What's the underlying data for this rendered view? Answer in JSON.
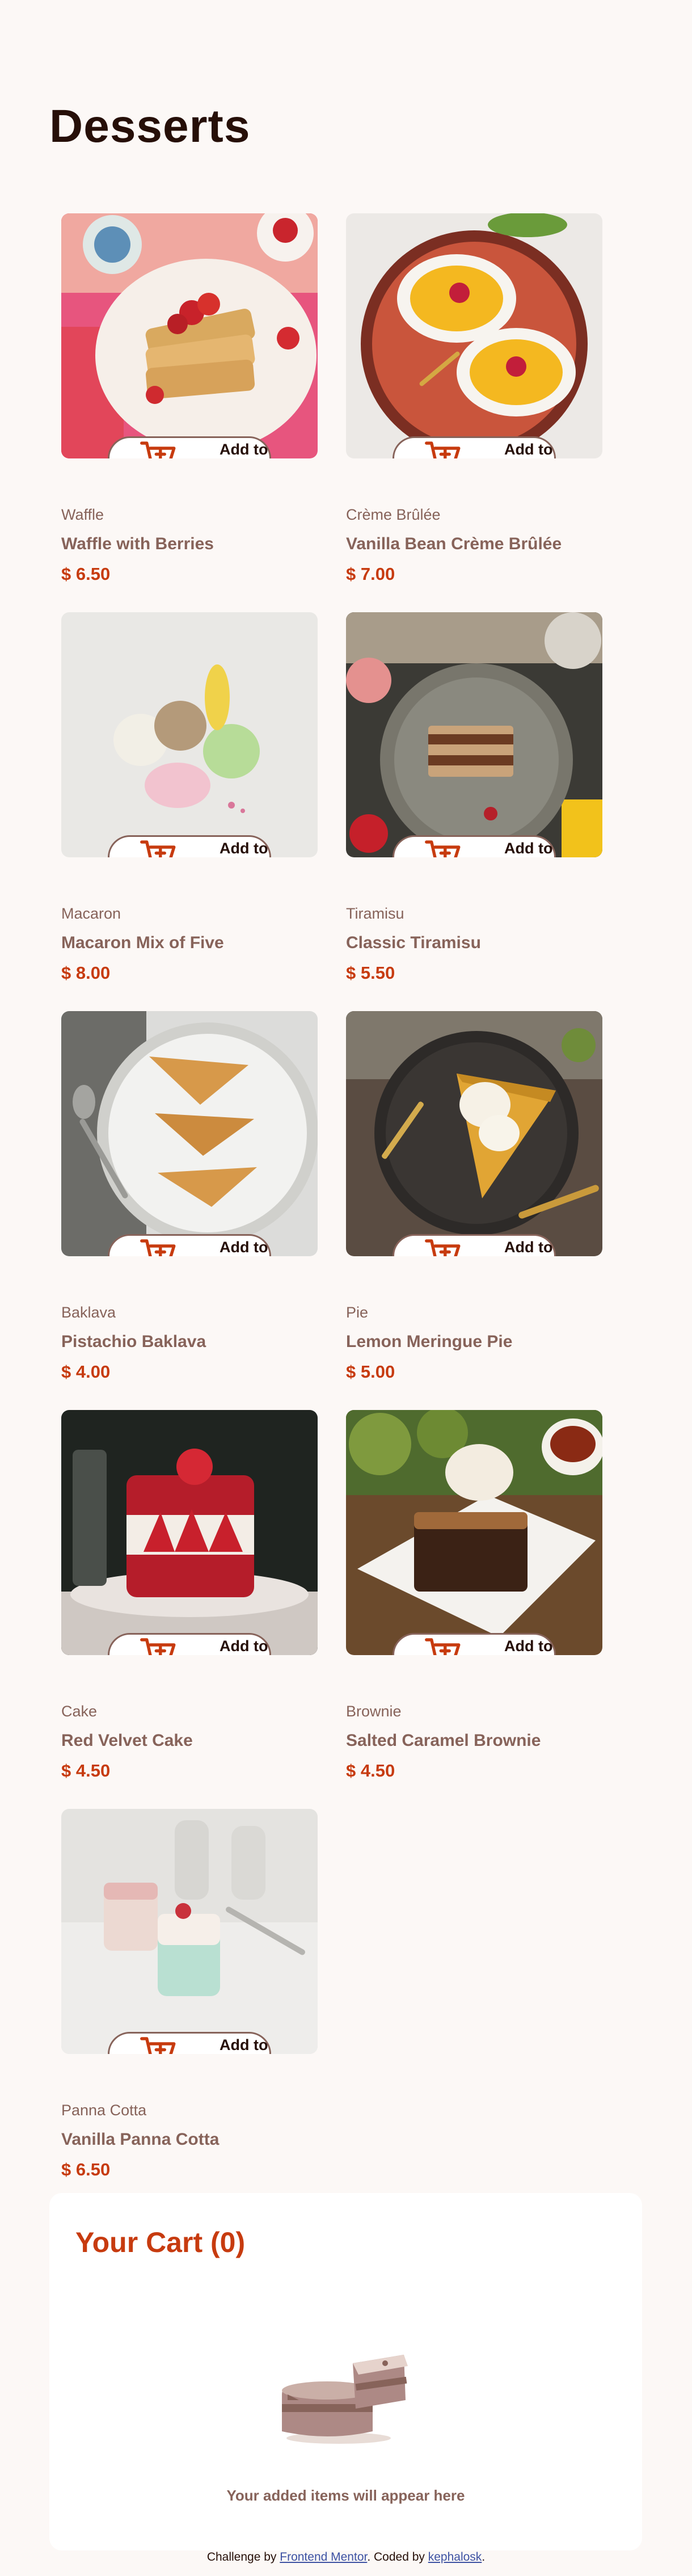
{
  "page": {
    "title": "Desserts"
  },
  "products": [
    {
      "category": "Waffle",
      "name": "Waffle with Berries",
      "price": "$ 6.50",
      "button": "Add to Cart",
      "image": "waffle"
    },
    {
      "category": "Crème Brûlée",
      "name": "Vanilla Bean Crème Brûlée",
      "price": "$ 7.00",
      "button": "Add to Cart",
      "image": "creme-brulee"
    },
    {
      "category": "Macaron",
      "name": "Macaron Mix of Five",
      "price": "$ 8.00",
      "button": "Add to Cart",
      "image": "macaron"
    },
    {
      "category": "Tiramisu",
      "name": "Classic Tiramisu",
      "price": "$ 5.50",
      "button": "Add to Cart",
      "image": "tiramisu"
    },
    {
      "category": "Baklava",
      "name": "Pistachio Baklava",
      "price": "$ 4.00",
      "button": "Add to Cart",
      "image": "baklava"
    },
    {
      "category": "Pie",
      "name": "Lemon Meringue Pie",
      "price": "$ 5.00",
      "button": "Add to Cart",
      "image": "pie"
    },
    {
      "category": "Cake",
      "name": "Red Velvet Cake",
      "price": "$ 4.50",
      "button": "Add to Cart",
      "image": "cake"
    },
    {
      "category": "Brownie",
      "name": "Salted Caramel Brownie",
      "price": "$ 4.50",
      "button": "Add to Cart",
      "image": "brownie"
    },
    {
      "category": "Panna Cotta",
      "name": "Vanilla Panna Cotta",
      "price": "$ 6.50",
      "button": "Add to Cart",
      "image": "panna-cotta"
    }
  ],
  "cart": {
    "title": "Your Cart (0)",
    "empty_message": "Your added items will appear here",
    "empty_icon": "empty-cart-cake-illustration"
  },
  "footer": {
    "prefix": "Challenge by ",
    "challenge_link": "Frontend Mentor",
    "middle": ". Coded by ",
    "author_link": "kephalosk",
    "suffix": "."
  },
  "colors": {
    "background": "#fcf8f6",
    "accent": "#c73b0f",
    "muted": "#87635a",
    "text": "#260f08"
  }
}
